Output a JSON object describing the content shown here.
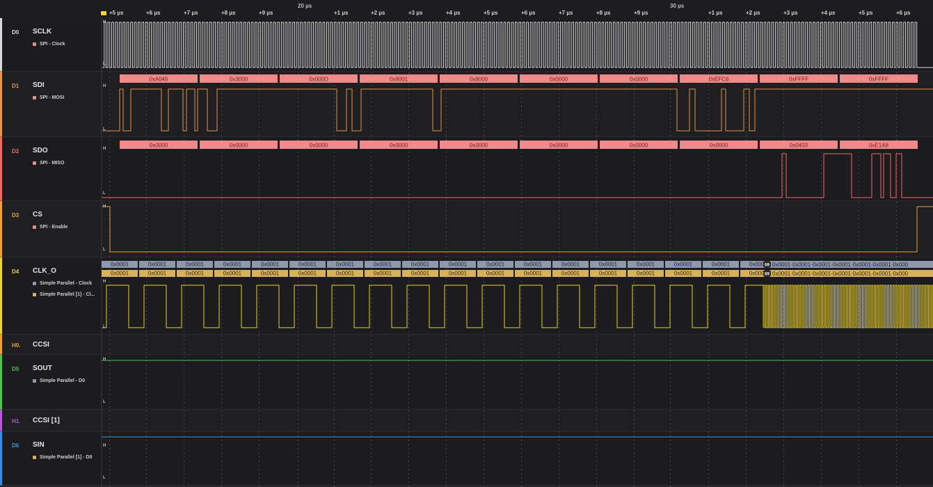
{
  "ruler": {
    "ticks": [
      {
        "label": "+5 µs"
      },
      {
        "label": "+6 µs"
      },
      {
        "label": "+7 µs"
      },
      {
        "label": "+8 µs"
      },
      {
        "label": "+9 µs"
      },
      {
        "label": "+1 µs"
      },
      {
        "label": "+2 µs"
      },
      {
        "label": "+3 µs"
      },
      {
        "label": "+4 µs"
      },
      {
        "label": "+5 µs"
      },
      {
        "label": "+6 µs"
      },
      {
        "label": "+7 µs"
      },
      {
        "label": "+8 µs"
      },
      {
        "label": "+9 µs"
      },
      {
        "label": "+1 µs"
      },
      {
        "label": "+2 µs"
      },
      {
        "label": "+3 µs"
      },
      {
        "label": "+4 µs"
      },
      {
        "label": "+5 µs"
      },
      {
        "label": "+6 µs"
      }
    ],
    "major": [
      {
        "label": "20 µs"
      },
      {
        "label": "30 µs"
      }
    ]
  },
  "level_high": "H",
  "level_low": "L",
  "channels": [
    {
      "id": "D0",
      "name": "SCLK",
      "color": "#d8d8d8",
      "analyzers": [
        {
          "label": "SPI - Clock",
          "color": "#f08a8a"
        }
      ]
    },
    {
      "id": "D1",
      "name": "SDI",
      "color": "#e2964a",
      "analyzers": [
        {
          "label": "SPI - MOSI",
          "color": "#f08a8a"
        }
      ]
    },
    {
      "id": "D2",
      "name": "SDO",
      "color": "#f06a6a",
      "analyzers": [
        {
          "label": "SPI - MISO",
          "color": "#f08a8a"
        }
      ]
    },
    {
      "id": "D3",
      "name": "CS",
      "color": "#e8a040",
      "analyzers": [
        {
          "label": "SPI - Enable",
          "color": "#f08a8a"
        }
      ]
    },
    {
      "id": "D4",
      "name": "CLK_O",
      "color": "#e6d23a",
      "analyzers": [
        {
          "label": "Simple Parallel - Clock",
          "color": "#8f98ad"
        },
        {
          "label": "Simple Parallel [1] - Cl...",
          "color": "#d9b15c"
        }
      ]
    },
    {
      "id": "H0.",
      "name": "CCSI",
      "color": "#e8a040",
      "analyzers": []
    },
    {
      "id": "D5",
      "name": "SOUT",
      "color": "#53c05a",
      "analyzers": [
        {
          "label": "Simple Parallel - D0",
          "color": "#8f98ad"
        }
      ]
    },
    {
      "id": "H1.",
      "name": "CCSI [1]",
      "color": "#b75ad6",
      "analyzers": []
    },
    {
      "id": "D6",
      "name": "SIN",
      "color": "#3a8fe0",
      "analyzers": [
        {
          "label": "Simple Parallel [1] - D0",
          "color": "#d9b15c"
        }
      ]
    }
  ],
  "mosi_frames": [
    "0xA045",
    "0x3000",
    "0x000D",
    "0x8001",
    "0x8000",
    "0x0000",
    "0x0000",
    "0xEFC6",
    "0xFFFF",
    "0xFFFF"
  ],
  "miso_frames": [
    "0x0000",
    "0x0000",
    "0x0000",
    "0x0000",
    "0x0000",
    "0x0000",
    "0x0000",
    "0x0000",
    "0x0403",
    "0xE1A8"
  ],
  "parallel_clock_frames": [
    "0x0001",
    "0x0001",
    "0x0001",
    "0x0001",
    "0x0001",
    "0x0001",
    "0x0001",
    "0x0001",
    "0x0001",
    "0x0001",
    "0x0001",
    "0x0001",
    "0x0001",
    "0x0001",
    "0x0001",
    "0x0001",
    "0x0001",
    "0x0001"
  ],
  "parallel_clock_count": "69",
  "parallel_clock_overflow": "0x0001·0x0001·0x0001·0x0001·0x0001·0x0001·0x000",
  "parallel1_frames": [
    "0x0001",
    "0x0001",
    "0x0001",
    "0x0001",
    "0x0001",
    "0x0001",
    "0x0001",
    "0x0001",
    "0x0001",
    "0x0001",
    "0x0001",
    "0x0001",
    "0x0001",
    "0x0001",
    "0x0001",
    "0x0001",
    "0x0001",
    "0x0001"
  ],
  "parallel1_count": "69",
  "parallel1_overflow": "0x0001·0x0001·0x0001·0x0001·0x0001·0x0001·0x000",
  "colors": {
    "spi_frame": "#f08a8a",
    "spi_frame_text": "#6a1e1e",
    "parallel_clock_frame": "#8f98ad",
    "parallel1_frame": "#d9b15c",
    "background": "#1b1b1d"
  }
}
